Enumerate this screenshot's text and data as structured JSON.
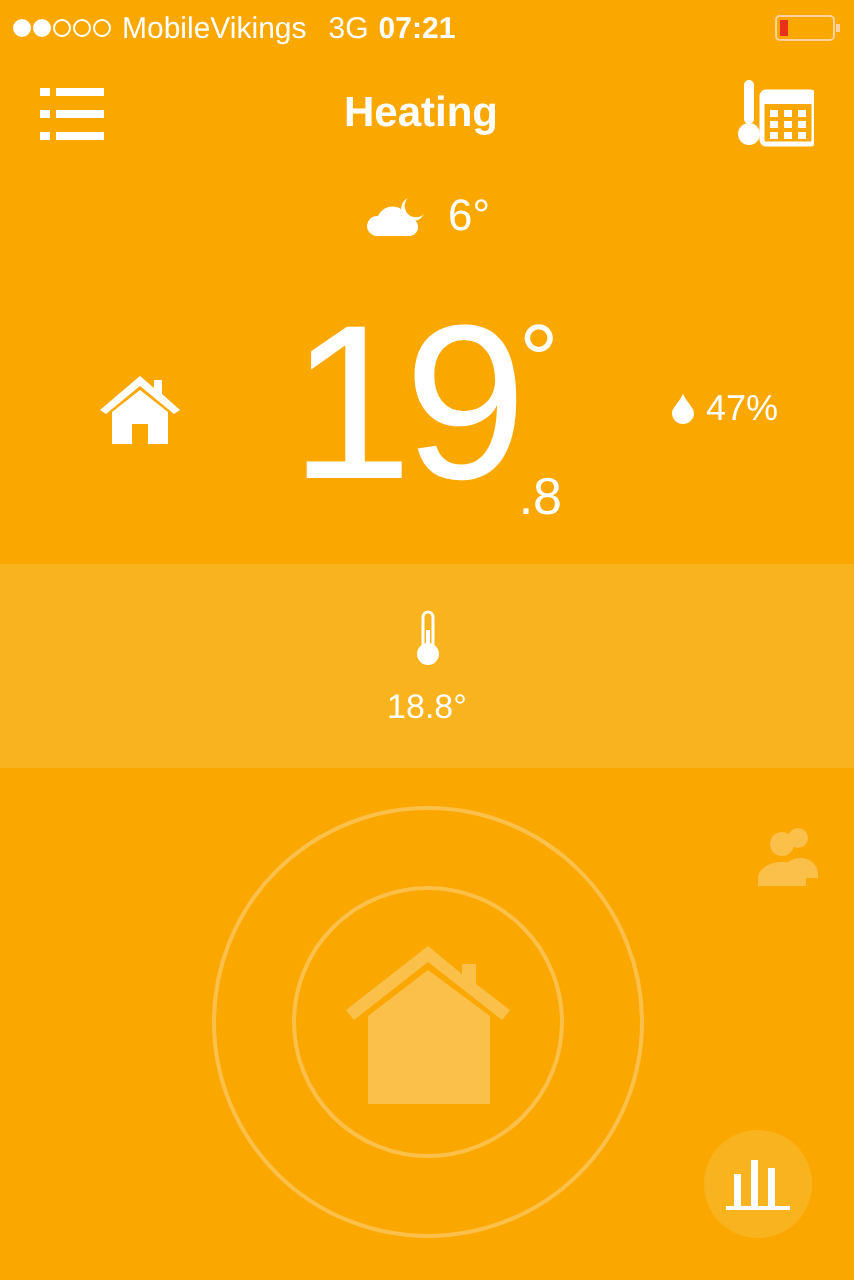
{
  "status_bar": {
    "carrier": "MobileVikings",
    "network": "3G",
    "time": "07:21"
  },
  "header": {
    "title": "Heating"
  },
  "weather": {
    "temperature": "6°"
  },
  "indoor": {
    "whole": "19",
    "degree": "°",
    "decimal": ".8",
    "humidity": "47%"
  },
  "thermostat": {
    "reading": "18.8°"
  }
}
